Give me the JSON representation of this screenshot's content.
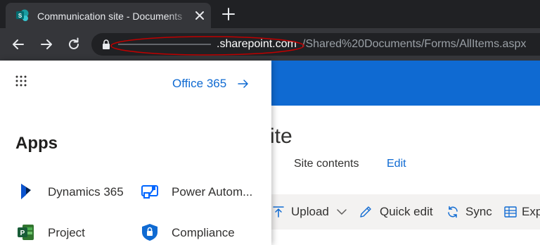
{
  "browser": {
    "tab_title": "Communication site - Documents",
    "url_host": ".sharepoint.com",
    "url_path": "/Shared%20Documents/Forms/AllItems.aspx"
  },
  "site": {
    "title_fragment": "ite",
    "nav": [
      "Site contents",
      "Edit"
    ]
  },
  "commands": [
    "Upload",
    "Quick edit",
    "Sync",
    "Exp"
  ],
  "launcher": {
    "office365_link": "Office 365",
    "apps_heading": "Apps",
    "apps": [
      {
        "label": "Dynamics 365",
        "icon": "dynamics-365-icon"
      },
      {
        "label": "Power Autom...",
        "icon": "power-automate-icon"
      },
      {
        "label": "Project",
        "icon": "project-icon"
      },
      {
        "label": "Compliance",
        "icon": "compliance-icon"
      }
    ]
  },
  "colors": {
    "chrome_dark": "#202124",
    "chrome_toolbar": "#35363a",
    "suite_bar": "#0f6ad2",
    "link_blue": "#0f6ad2",
    "annotation_red": "#c00000",
    "sharepoint_teal": "#038387"
  }
}
